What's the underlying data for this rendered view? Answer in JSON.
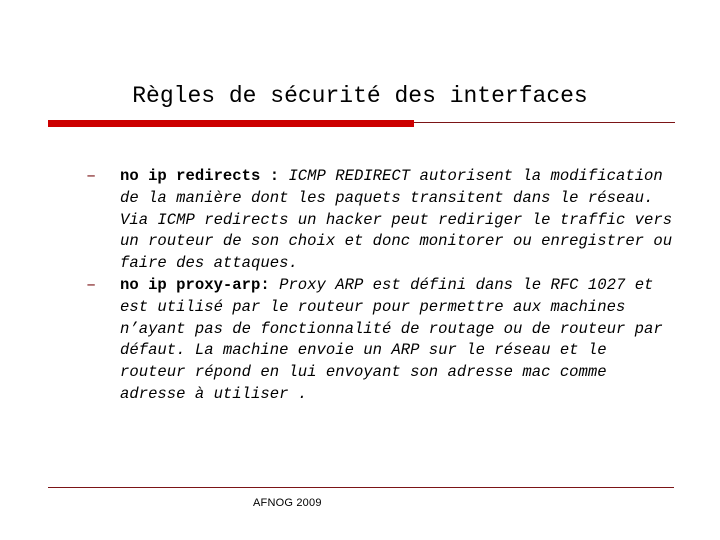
{
  "slide": {
    "title": "Règles de sécurité des interfaces",
    "accent_color": "#cc0000",
    "rule_color": "#7b1416",
    "text_color": "#000000",
    "background_color": "#ffffff"
  },
  "bullets": [
    {
      "marker": "–",
      "lead": "no ip redirects :",
      "rest": "  ICMP REDIRECT autorisent la modification de la manière dont les paquets transitent dans le réseau. Via ICMP redirects un hacker peut rediriger le traffic vers un routeur de son choix et donc monitorer ou enregistrer ou faire des attaques."
    },
    {
      "marker": "–",
      "lead": "no ip proxy-arp:",
      "rest": " Proxy ARP est défini dans le RFC 1027 et est utilisé par le routeur pour permettre aux machines n’ayant pas de fonctionnalité de routage ou de routeur par défaut. La machine envoie un ARP sur le réseau et le routeur répond en lui envoyant son adresse mac comme adresse à utiliser ."
    }
  ],
  "footer": {
    "text": "AFNOG 2009"
  }
}
